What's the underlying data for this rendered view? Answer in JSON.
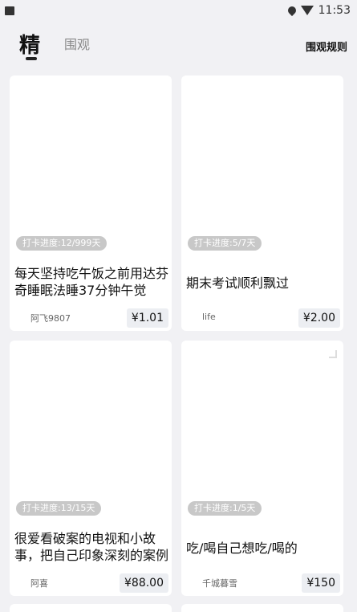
{
  "status": {
    "time": "11:53"
  },
  "header": {
    "tab_active": "精",
    "tab_inactive": "围观",
    "rules_link": "围观规则"
  },
  "cards": [
    {
      "progress": "打卡进度:12/999天",
      "title": "每天坚持吃午饭之前用达芬奇睡眠法睡37分钟午觉",
      "user": "阿飞9807",
      "price": "¥1.01"
    },
    {
      "progress": "打卡进度:5/7天",
      "title": "期末考试顺利飘过",
      "user": "life",
      "price": "¥2.00"
    },
    {
      "progress": "打卡进度:13/15天",
      "title": "很爱看破案的电视和小故事，把自己印象深刻的案例",
      "user": "阿喜",
      "price": "¥88.00"
    },
    {
      "progress": "打卡进度:1/5天",
      "title": "吃/喝自己想吃/喝的",
      "user": "千城暮雪",
      "price": "¥150"
    }
  ]
}
